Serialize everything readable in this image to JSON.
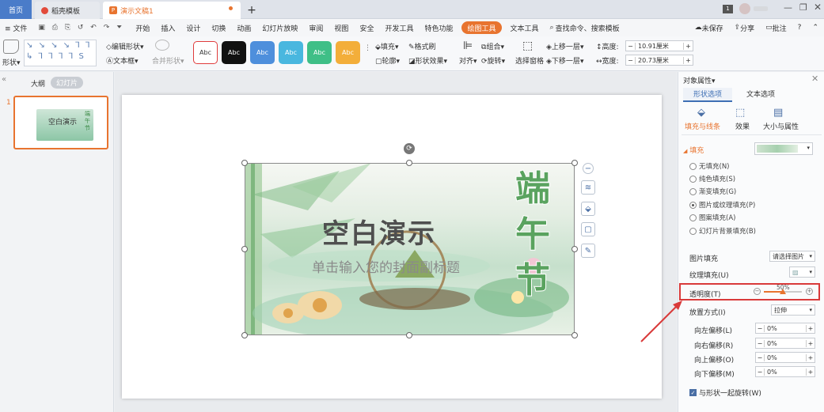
{
  "tabs": {
    "home": "首页",
    "templates": "稻壳模板",
    "doc": "演示文稿1",
    "add": "+",
    "badge": "1"
  },
  "menu": {
    "file": "≡ 文件",
    "items": [
      "开始",
      "插入",
      "设计",
      "切换",
      "动画",
      "幻灯片放映",
      "审阅",
      "视图",
      "安全",
      "开发工具",
      "特色功能"
    ],
    "active": "绘图工具",
    "text_tools": "文本工具",
    "search": "查找命令、搜索模板",
    "unsaved": "未保存",
    "share": "分享",
    "annotate": "批注"
  },
  "toolbar": {
    "shape": "形状",
    "edit_shape": "编辑形状",
    "text_box": "文本框",
    "merge_shape": "合并形状",
    "style_label": "Abc",
    "fill": "填充",
    "format_brush": "格式刷",
    "outline": "轮廓",
    "shape_effect": "形状效果",
    "align": "对齐",
    "group": "组合",
    "rotate": "旋转",
    "selection_pane": "选择窗格",
    "bring_forward": "上移一层",
    "send_backward": "下移一层",
    "height_label": "高度:",
    "height_value": "10.91厘米",
    "width_label": "宽度:",
    "width_value": "20.73厘米"
  },
  "left": {
    "outline": "大纲",
    "slides": "幻灯片",
    "slide_num": "1",
    "thumb_title": "空白演示",
    "thumb_side": "端午节"
  },
  "slide": {
    "title": "空白演示",
    "subtitle": "单击输入您的封面副标题",
    "vertical": [
      "端",
      "午",
      "节"
    ]
  },
  "panel": {
    "title": "对象属性",
    "tab_shape": "形状选项",
    "tab_text": "文本选项",
    "sub_fill": "填充与线条",
    "sub_effect": "效果",
    "sub_size": "大小与属性",
    "fill_header": "填充",
    "options": [
      "无填充(N)",
      "纯色填充(S)",
      "渐变填充(G)",
      "图片或纹理填充(P)",
      "图案填充(A)",
      "幻灯片背景填充(B)"
    ],
    "pic_fill_label": "图片填充",
    "pic_fill_value": "请选择图片",
    "texture_label": "纹理填充(U)",
    "transparency_label": "透明度(T)",
    "transparency_value": "50%",
    "placement_label": "放置方式(I)",
    "placement_value": "拉伸",
    "offsets": [
      {
        "label": "向左偏移(L)",
        "value": "0%"
      },
      {
        "label": "向右偏移(R)",
        "value": "0%"
      },
      {
        "label": "向上偏移(O)",
        "value": "0%"
      },
      {
        "label": "向下偏移(M)",
        "value": "0%"
      }
    ],
    "rotate_with_shape": "与形状一起旋转(W)"
  },
  "colors": {
    "accent": "#e8742f",
    "highlight": "#d93a3a",
    "green": "#5aa35f",
    "selected_tab": "#3e6fb4"
  },
  "transparency_fraction": 0.5
}
